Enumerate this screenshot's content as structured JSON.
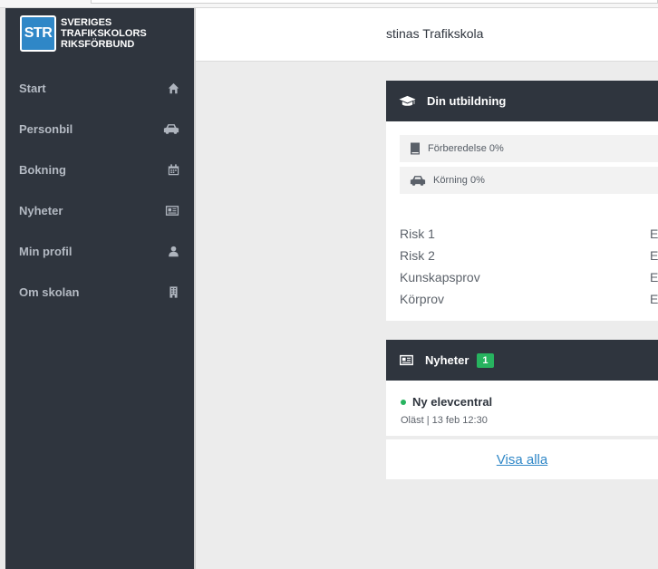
{
  "brand": {
    "logo_mark": "STR",
    "lines": [
      "SVERIGES",
      "TRAFIKSKOLORS",
      "RIKSFÖRBUND"
    ]
  },
  "sidebar": {
    "items": [
      {
        "label": "Start",
        "icon": "home-icon"
      },
      {
        "label": "Personbil",
        "icon": "car-icon"
      },
      {
        "label": "Bokning",
        "icon": "calendar-icon"
      },
      {
        "label": "Nyheter",
        "icon": "newspaper-icon"
      },
      {
        "label": "Min profil",
        "icon": "user-icon"
      },
      {
        "label": "Om skolan",
        "icon": "building-icon"
      }
    ]
  },
  "header": {
    "school_name": "stinas Trafikskola"
  },
  "education": {
    "title": "Din utbildning",
    "progress": [
      {
        "label": "Förberedelse 0%",
        "value": 0,
        "icon": "book-icon"
      },
      {
        "label": "Körning 0%",
        "value": 0,
        "icon": "car-icon"
      }
    ],
    "tests": [
      {
        "name": "Risk 1",
        "status": "Ej"
      },
      {
        "name": "Risk 2",
        "status": "Ej"
      },
      {
        "name": "Kunskapsprov",
        "status": "Ej"
      },
      {
        "name": "Körprov",
        "status": "Ej"
      }
    ]
  },
  "news": {
    "title": "Nyheter",
    "count": "1",
    "items": [
      {
        "title": "Ny elevcentral",
        "meta": "Oläst | 13 feb 12:30"
      }
    ],
    "show_all": "Visa alla"
  },
  "colors": {
    "sidebar": "#2f353e",
    "accent": "#2f87c7",
    "badge": "#27b35f"
  }
}
